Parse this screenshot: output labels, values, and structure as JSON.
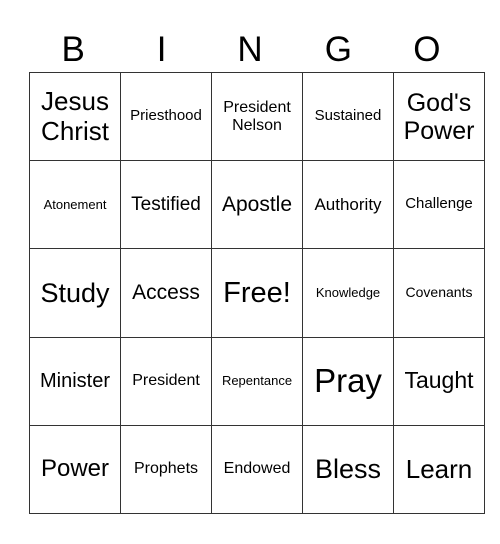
{
  "header": {
    "letters": [
      "B",
      "I",
      "N",
      "G",
      "O"
    ]
  },
  "card": {
    "rows": [
      [
        "Jesus Christ",
        "Priesthood",
        "President Nelson",
        "Sustained",
        "God's Power"
      ],
      [
        "Atonement",
        "Testified",
        "Apostle",
        "Authority",
        "Challenge"
      ],
      [
        "Study",
        "Access",
        "Free!",
        "Knowledge",
        "Covenants"
      ],
      [
        "Minister",
        "President",
        "Repentance",
        "Pray",
        "Taught"
      ],
      [
        "Power",
        "Prophets",
        "Endowed",
        "Bless",
        "Learn"
      ]
    ]
  }
}
